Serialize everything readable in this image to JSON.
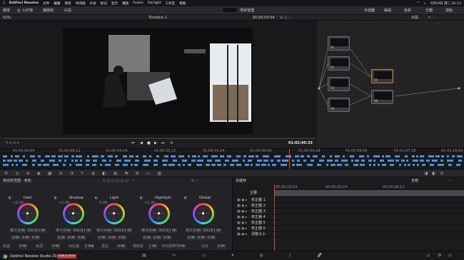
{
  "menubar": {
    "app": "DaVinci Resolve",
    "items": [
      "文件",
      "编辑",
      "修剪",
      "时间线",
      "片段",
      "标记",
      "显示",
      "播放",
      "Fusion",
      "Fairlight",
      "工作区",
      "帮助"
    ],
    "clock": "5月19日 周二 01:12"
  },
  "toolbar": {
    "left_items": [
      "媒体",
      "LUT库",
      "播放库",
      "片段"
    ],
    "center_title": "项目管理",
    "right_items": [
      "示波器",
      "曲线",
      "色彩",
      "光箱",
      "调色"
    ]
  },
  "viewer": {
    "zoom": "52%",
    "timeline_name": "Timeline 1",
    "src_timecode": "00:00:03:04",
    "clip_label": "片段",
    "current_timecode": "01:02:45:33"
  },
  "mini_timeline": {
    "ticks": [
      "01:00:00:00",
      "01:00:08:12",
      "01:00:16:24",
      "01:00:25:12",
      "01:00:33:24",
      "01:00:42:06",
      "01:00:50:18",
      "01:00:59:06",
      "01:01:07:18",
      "01:01:16:00"
    ]
  },
  "nodes": [
    {
      "label": "01"
    },
    {
      "label": "02"
    },
    {
      "label": "03"
    },
    {
      "label": "04"
    },
    {
      "label": "05"
    },
    {
      "label": "06"
    }
  ],
  "wheels": {
    "panel_title": "高动态范围 - 色轮",
    "names": [
      "Dark",
      "Shadow",
      "Light",
      "Highlight",
      "Global"
    ],
    "exposure_label": "曝光",
    "saturation_label": "饱和度",
    "exp_val": "0.00",
    "sat_val": "1.00",
    "rgb_vals": [
      "0.00",
      "0.00",
      "0.00"
    ],
    "lum": [
      "+2.00",
      "+1.00",
      "0.00",
      "+1.00",
      ""
    ],
    "bottom_labels": [
      "色温",
      "色调",
      "对比度",
      "黑位",
      "饱和度",
      "中间调细节",
      "白点"
    ],
    "bottom_vals": [
      "0.00",
      "0.00",
      "1.000",
      "0.00",
      "1.00",
      "0.00",
      "0.00"
    ]
  },
  "keyframes": {
    "title": "关键帧",
    "mode": "全部",
    "ticks": [
      "00:00:03:04",
      "00:00:05:24",
      "00:00:08:12"
    ],
    "master": "主要",
    "rows": [
      "校正器 1",
      "校正器 2",
      "校正器 3",
      "校正器 4",
      "校正器 5",
      "校正器 6",
      "调整大小"
    ]
  },
  "bottom": {
    "product": "DaVinci Resolve Studio 20",
    "badge": "PUBLIC BETA"
  }
}
